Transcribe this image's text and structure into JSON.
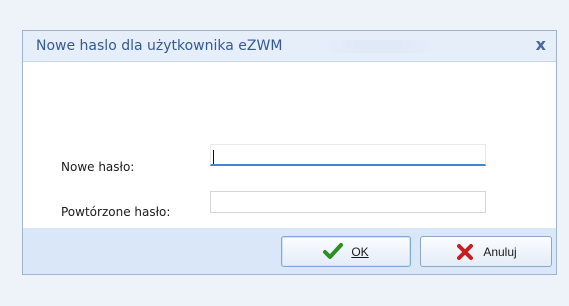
{
  "dialog": {
    "title": "Nowe haslo dla użytkownika eZWM",
    "close_label": "x"
  },
  "form": {
    "new_password_label": "Nowe hasło:",
    "new_password_value": "",
    "repeat_password_label": "Powtórzone hasło:",
    "repeat_password_value": ""
  },
  "buttons": {
    "ok_label": "OK",
    "cancel_label": "Anuluj"
  },
  "icons": {
    "ok_icon": "checkmark-icon",
    "cancel_icon": "x-icon"
  },
  "colors": {
    "accent": "#3f86d2",
    "title": "#355a93",
    "dialog_bg": "#d9e7f8"
  }
}
